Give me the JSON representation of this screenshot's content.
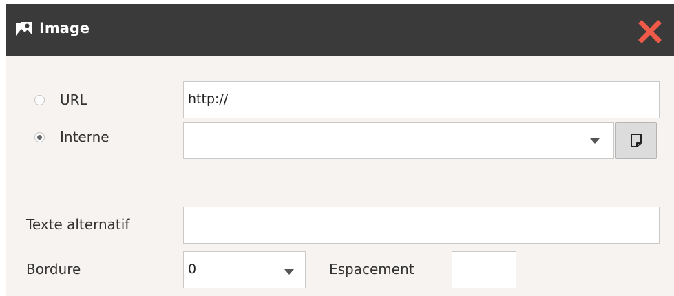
{
  "dialog": {
    "title": "Image",
    "title_icon": "image-icon",
    "close_icon": "close-icon"
  },
  "source": {
    "options": [
      {
        "label": "URL",
        "selected": false
      },
      {
        "label": "Interne",
        "selected": true
      }
    ],
    "url_value": "http://",
    "internal_value": "",
    "browse_icon": "document-icon"
  },
  "alt_text": {
    "label": "Texte alternatif",
    "value": ""
  },
  "border": {
    "label": "Bordure",
    "value": "0"
  },
  "spacing": {
    "label": "Espacement",
    "value": ""
  },
  "colors": {
    "titlebar": "#3a3a3a",
    "close": "#f05a48",
    "body": "#f6f3f1"
  }
}
